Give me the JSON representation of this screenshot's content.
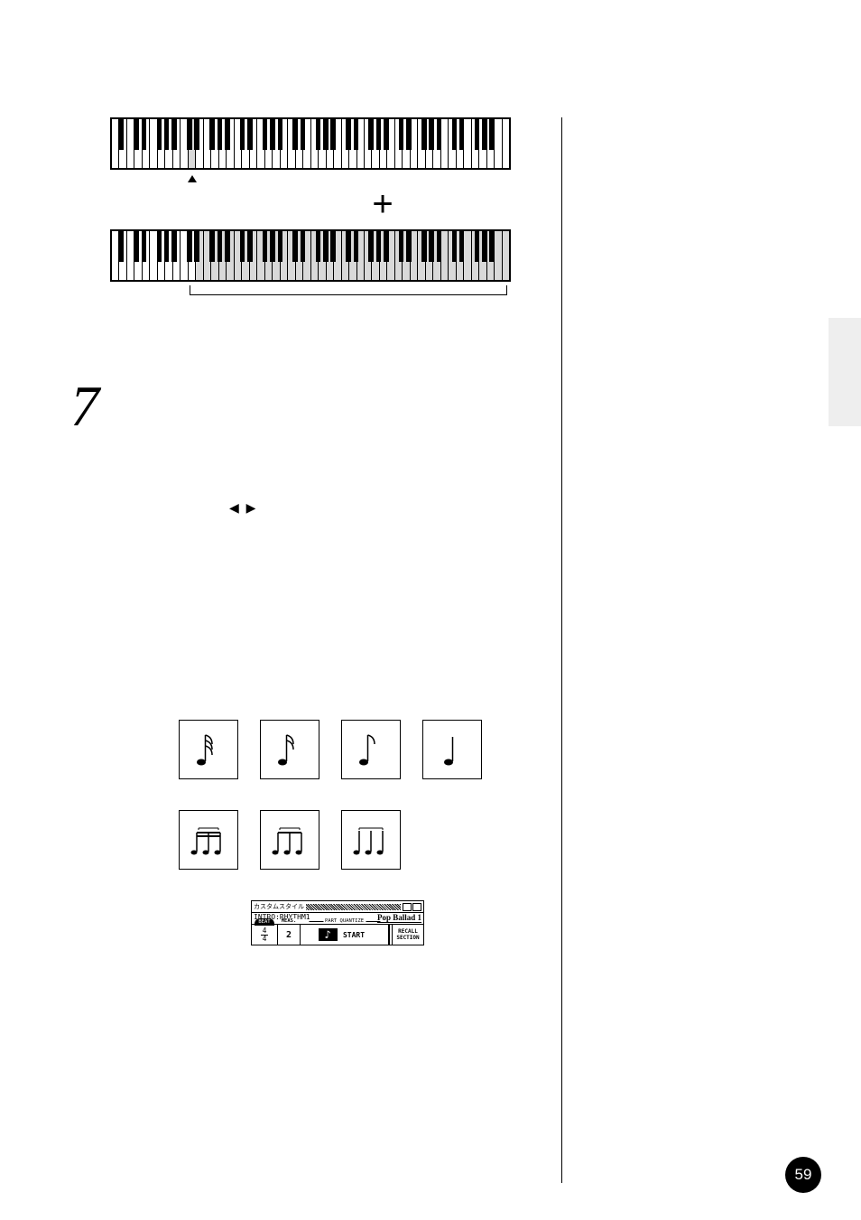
{
  "page_number": "59",
  "diagram": {
    "plus": "+"
  },
  "step": {
    "number": "7",
    "nav_icons": "◀ ▶"
  },
  "lcd": {
    "title": "カスタムスタイル",
    "section": "INTRO:RHYTHM1",
    "style_name": "Pop Ballad 1",
    "beat_label": "BEAT",
    "beat_num": "4",
    "beat_den": "4",
    "meas_label": "MEAS.",
    "meas_value": "2",
    "quantize_label": "PART QUANTIZE",
    "note_symbol": "♪",
    "start": "START",
    "recall_line1": "RECALL",
    "recall_line2": "SECTION"
  }
}
